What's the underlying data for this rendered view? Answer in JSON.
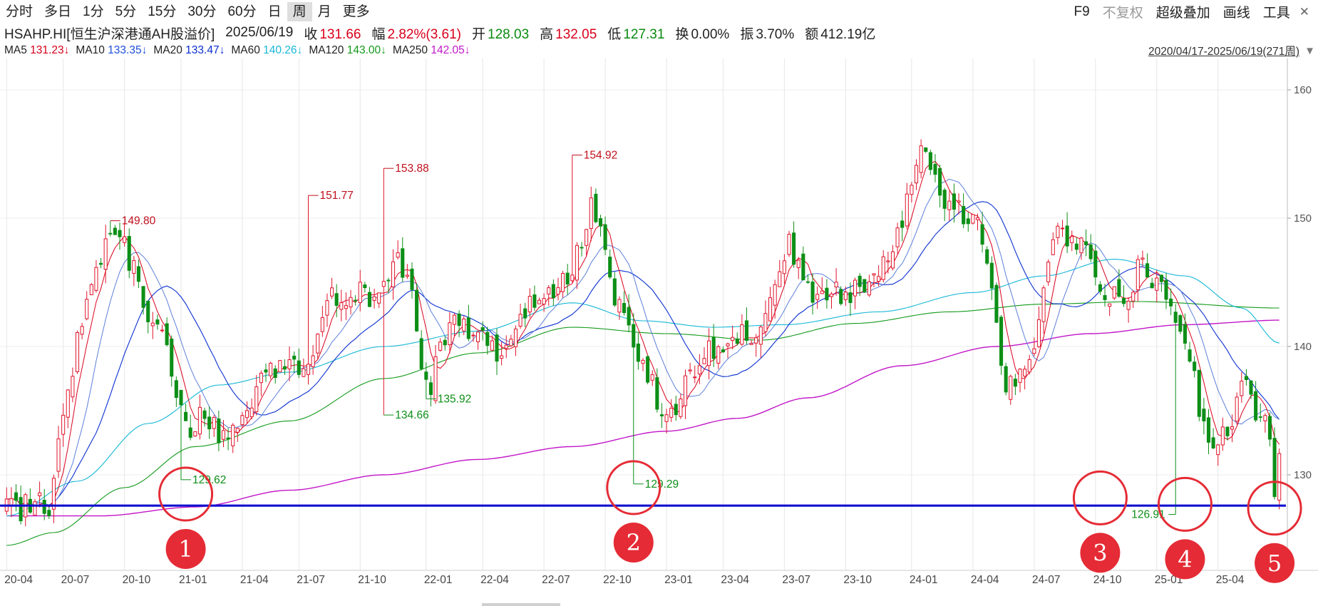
{
  "toolbar": {
    "periods": [
      "分时",
      "多日",
      "1分",
      "5分",
      "15分",
      "30分",
      "60分",
      "日",
      "周",
      "月",
      "更多"
    ],
    "active_period": "周",
    "tools": {
      "f9": "F9",
      "adjust": "不复权",
      "overlay": "超级叠加",
      "draw": "画线",
      "tools": "工具",
      "close": "✕"
    }
  },
  "quote": {
    "name": "HSAHP.HI[恒生沪深港通AH股溢价]",
    "date": "2025/06/19",
    "close_label": "收",
    "close": "131.66",
    "change_label": "幅",
    "change": "2.82%(3.61)",
    "open_label": "开",
    "open": "128.03",
    "high_label": "高",
    "high": "132.05",
    "low_label": "低",
    "low": "127.31",
    "turnover_label": "换",
    "turnover": "0.00%",
    "amplitude_label": "振",
    "amplitude": "3.70%",
    "amount_label": "额",
    "amount": "412.19亿"
  },
  "ma": [
    {
      "name": "MA5",
      "value": "131.23↓",
      "color": "#d9001b"
    },
    {
      "name": "MA10",
      "value": "133.35↓",
      "color": "#1e4fd8"
    },
    {
      "name": "MA20",
      "value": "133.47↓",
      "color": "#0a2fd0"
    },
    {
      "name": "MA60",
      "value": "140.26↓",
      "color": "#17b8d6"
    },
    {
      "name": "MA120",
      "value": "143.00↓",
      "color": "#139a1b"
    },
    {
      "name": "MA250",
      "value": "142.05↓",
      "color": "#c216c8"
    }
  ],
  "range": "2020/04/17-2025/06/19(271周)",
  "range_arrow": "▼",
  "colors": {
    "up": "#e0142a",
    "down": "#0d8f17",
    "support": "#1010d0",
    "circle": "#e52b35"
  },
  "chart_data": {
    "type": "candlestick",
    "timeframe": "weekly",
    "ylim": [
      123,
      162
    ],
    "yticks": [
      130,
      140,
      150,
      160
    ],
    "xticks": [
      {
        "label": "20-04",
        "week": 0
      },
      {
        "label": "20-07",
        "week": 12
      },
      {
        "label": "20-10",
        "week": 25
      },
      {
        "label": "21-01",
        "week": 37
      },
      {
        "label": "21-04",
        "week": 50
      },
      {
        "label": "21-07",
        "week": 62
      },
      {
        "label": "21-10",
        "week": 75
      },
      {
        "label": "22-01",
        "week": 89
      },
      {
        "label": "22-04",
        "week": 101
      },
      {
        "label": "22-07",
        "week": 114
      },
      {
        "label": "22-10",
        "week": 127
      },
      {
        "label": "23-01",
        "week": 140
      },
      {
        "label": "23-04",
        "week": 152
      },
      {
        "label": "23-07",
        "week": 165
      },
      {
        "label": "23-10",
        "week": 178
      },
      {
        "label": "24-01",
        "week": 192
      },
      {
        "label": "24-04",
        "week": 205
      },
      {
        "label": "24-07",
        "week": 218
      },
      {
        "label": "24-10",
        "week": 231
      },
      {
        "label": "25-01",
        "week": 244
      },
      {
        "label": "25-04",
        "week": 257
      }
    ],
    "anchors": [
      [
        0,
        127.6
      ],
      [
        3,
        127.4
      ],
      [
        6,
        128.2
      ],
      [
        9,
        126.9
      ],
      [
        12,
        134.5
      ],
      [
        15,
        140.5
      ],
      [
        18,
        145.5
      ],
      [
        21,
        147.8
      ],
      [
        24,
        148.6
      ],
      [
        27,
        146
      ],
      [
        30,
        142
      ],
      [
        33,
        140.5
      ],
      [
        36,
        136.5
      ],
      [
        39,
        133.8
      ],
      [
        42,
        134.5
      ],
      [
        45,
        133
      ],
      [
        48,
        133.5
      ],
      [
        51,
        135.5
      ],
      [
        54,
        137.5
      ],
      [
        57,
        138
      ],
      [
        60,
        139
      ],
      [
        63,
        138.2
      ],
      [
        66,
        140.5
      ],
      [
        68,
        144.5
      ],
      [
        71,
        143.5
      ],
      [
        74,
        144.5
      ],
      [
        77,
        143.2
      ],
      [
        80,
        145
      ],
      [
        83,
        146.8
      ],
      [
        86,
        144
      ],
      [
        88,
        137.5
      ],
      [
        90,
        137
      ],
      [
        93,
        141
      ],
      [
        96,
        142.5
      ],
      [
        99,
        141
      ],
      [
        101,
        140.5
      ],
      [
        104,
        139.5
      ],
      [
        107,
        140.5
      ],
      [
        110,
        143
      ],
      [
        113,
        144.5
      ],
      [
        116,
        144
      ],
      [
        119,
        145.5
      ],
      [
        122,
        148
      ],
      [
        124,
        151
      ],
      [
        126,
        149
      ],
      [
        129,
        144
      ],
      [
        132,
        141
      ],
      [
        135,
        139
      ],
      [
        138,
        136
      ],
      [
        140,
        134
      ],
      [
        143,
        136
      ],
      [
        146,
        138.5
      ],
      [
        149,
        139.5
      ],
      [
        152,
        140.5
      ],
      [
        155,
        140.8
      ],
      [
        158,
        140.5
      ],
      [
        160,
        142.5
      ],
      [
        163,
        144.5
      ],
      [
        166,
        148.5
      ],
      [
        168,
        146
      ],
      [
        171,
        143.5
      ],
      [
        174,
        144.5
      ],
      [
        177,
        143.8
      ],
      [
        180,
        144.5
      ],
      [
        183,
        145
      ],
      [
        186,
        147
      ],
      [
        189,
        148.5
      ],
      [
        192,
        152.5
      ],
      [
        194,
        156.5
      ],
      [
        197,
        153
      ],
      [
        200,
        150.5
      ],
      [
        203,
        150.5
      ],
      [
        206,
        149.5
      ],
      [
        208,
        145.5
      ],
      [
        210,
        142
      ],
      [
        212,
        136.5
      ],
      [
        215,
        138
      ],
      [
        218,
        140.5
      ],
      [
        221,
        147
      ],
      [
        223,
        148.5
      ],
      [
        226,
        148
      ],
      [
        229,
        147.5
      ],
      [
        231,
        146.2
      ],
      [
        232,
        143.5
      ],
      [
        235,
        144
      ],
      [
        238,
        144.5
      ],
      [
        241,
        146.5
      ],
      [
        244,
        145
      ],
      [
        247,
        143.5
      ],
      [
        250,
        141
      ],
      [
        252,
        137.5
      ],
      [
        254,
        133.5
      ],
      [
        256,
        131.5
      ],
      [
        258,
        133.5
      ],
      [
        260,
        134.5
      ],
      [
        262,
        137.5
      ],
      [
        264,
        136
      ],
      [
        266,
        134.5
      ],
      [
        268,
        133
      ],
      [
        269,
        128.3
      ],
      [
        270,
        131.6
      ]
    ],
    "peak_labels": [
      {
        "value": "149.80",
        "week": 22,
        "price": 149.8
      },
      {
        "value": "151.77",
        "week": 64,
        "price": 151.77
      },
      {
        "value": "153.88",
        "week": 80,
        "price": 153.88
      },
      {
        "value": "154.92",
        "week": 120,
        "price": 154.92
      }
    ],
    "trough_labels": [
      {
        "value": "129.62",
        "week": 37,
        "price": 129.62
      },
      {
        "value": "134.66",
        "week": 80,
        "price": 134.66
      },
      {
        "value": "135.92",
        "week": 89,
        "price": 135.92
      },
      {
        "value": "129.29",
        "week": 133,
        "price": 129.29
      },
      {
        "value": "126.91",
        "week": 248,
        "price": 126.91
      }
    ],
    "ma_shape": {
      "MA250": [
        [
          0,
          126.8
        ],
        [
          20,
          126.8
        ],
        [
          40,
          127.5
        ],
        [
          60,
          128.8
        ],
        [
          80,
          130
        ],
        [
          100,
          131.2
        ],
        [
          120,
          132.2
        ],
        [
          140,
          133.4
        ],
        [
          155,
          134.4
        ],
        [
          170,
          136
        ],
        [
          190,
          138.5
        ],
        [
          210,
          140
        ],
        [
          230,
          141
        ],
        [
          250,
          141.7
        ],
        [
          270,
          142.05
        ]
      ],
      "MA120": [
        [
          0,
          124.5
        ],
        [
          10,
          125.5
        ],
        [
          25,
          129
        ],
        [
          40,
          132.2
        ],
        [
          60,
          134.2
        ],
        [
          80,
          137.5
        ],
        [
          100,
          139.5
        ],
        [
          120,
          141.5
        ],
        [
          140,
          141
        ],
        [
          160,
          140.5
        ],
        [
          180,
          141.8
        ],
        [
          200,
          142.7
        ],
        [
          220,
          143.3
        ],
        [
          240,
          143.5
        ],
        [
          270,
          143.0
        ]
      ],
      "MA60": [
        [
          0,
          126.8
        ],
        [
          15,
          129.5
        ],
        [
          30,
          134
        ],
        [
          45,
          137
        ],
        [
          60,
          138
        ],
        [
          80,
          140
        ],
        [
          100,
          141.2
        ],
        [
          120,
          143.4
        ],
        [
          135,
          142
        ],
        [
          150,
          141.5
        ],
        [
          165,
          141.7
        ],
        [
          185,
          142.7
        ],
        [
          205,
          144.2
        ],
        [
          220,
          145.5
        ],
        [
          235,
          146.8
        ],
        [
          250,
          145.5
        ],
        [
          262,
          143
        ],
        [
          270,
          140.26
        ]
      ]
    },
    "support_line": 127.6,
    "circles": [
      {
        "label": "1",
        "week": 38,
        "price": 128.5
      },
      {
        "label": "2",
        "week": 133,
        "price": 129
      },
      {
        "label": "3",
        "week": 232,
        "price": 128.2
      },
      {
        "label": "4",
        "week": 250,
        "price": 127.7
      },
      {
        "label": "5",
        "week": 269,
        "price": 127.4
      }
    ]
  }
}
